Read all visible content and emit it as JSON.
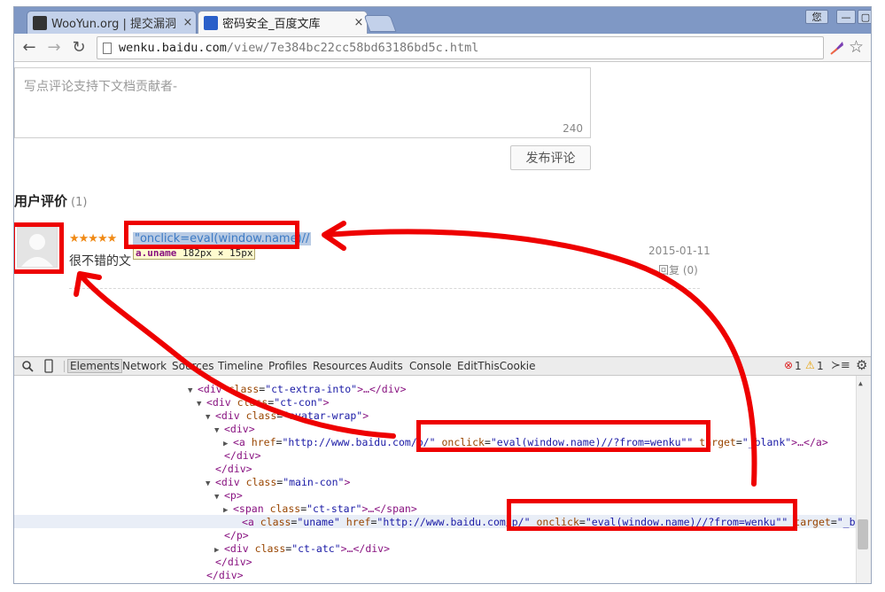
{
  "tabs": [
    {
      "label": "WooYun.org | 提交漏洞",
      "close": "×"
    },
    {
      "label": "密码安全_百度文库",
      "close": "×"
    }
  ],
  "window_buttons": {
    "user": "您",
    "minimize": "—",
    "restore": "▢"
  },
  "address_bar": {
    "host": "wenku.baidu.com",
    "path": "/view/7e384bc22cc58bd63186bd5c.html"
  },
  "nav_glyphs": {
    "back": "←",
    "forward": "→",
    "reload": "↻",
    "star": "☆"
  },
  "comment_form": {
    "placeholder": "写点评论支持下文档贡献者-",
    "char_count": "240",
    "submit_label": "发布评论"
  },
  "reviews": {
    "title": "用户评价",
    "count": "(1)",
    "items": [
      {
        "stars": "★★★★★",
        "username": "\"onclick=eval(window.name)//",
        "text": "很不错的文",
        "date": "2015-01-11",
        "reply": "回复 (0)"
      }
    ]
  },
  "inspect_tooltip": {
    "tag": "a.uname",
    "size": "182px × 15px",
    "w": "182",
    "h": "15"
  },
  "devtools": {
    "tabs": [
      "Elements",
      "Network",
      "Sources",
      "Timeline",
      "Profiles",
      "Resources",
      "Audits",
      "Console",
      "EditThisCookie"
    ],
    "errors": "1",
    "warnings": "1",
    "lines": [
      {
        "tri": "▼",
        "html": "<div class=\"ct-extra-into\">…</div>"
      },
      {
        "tri": "▼",
        "html": "<div class=\"ct-con\">"
      },
      {
        "tri": "▼",
        "html": "<div class=\"avatar-wrap\">"
      },
      {
        "tri": "▼",
        "html": "<div>"
      },
      {
        "tri": "▶",
        "html": "<a href=\"http://www.baidu.com/p/\" onclick=\"eval(window.name)//?from=wenku\"\" target=\"_blank\">…</a>"
      },
      {
        "tri": "",
        "html": "</div>"
      },
      {
        "tri": "",
        "html": "</div>"
      },
      {
        "tri": "▼",
        "html": "<div class=\"main-con\">"
      },
      {
        "tri": "▼",
        "html": "<p>"
      },
      {
        "tri": "▶",
        "html": "<span class=\"ct-star\">…</span>"
      },
      {
        "tri": "",
        "html": "<a class=\"uname\" href=\"http://www.baidu.com/p/\" onclick=\"eval(window.name)//?from=wenku\"\" target=\"_bl"
      },
      {
        "tri": "",
        "html": "</p>"
      },
      {
        "tri": "▶",
        "html": "<div class=\"ct-atc\">…</div>"
      },
      {
        "tri": "",
        "html": "</div>"
      },
      {
        "tri": "",
        "html": "</div>"
      }
    ]
  },
  "annotation_color": "#ee0000"
}
